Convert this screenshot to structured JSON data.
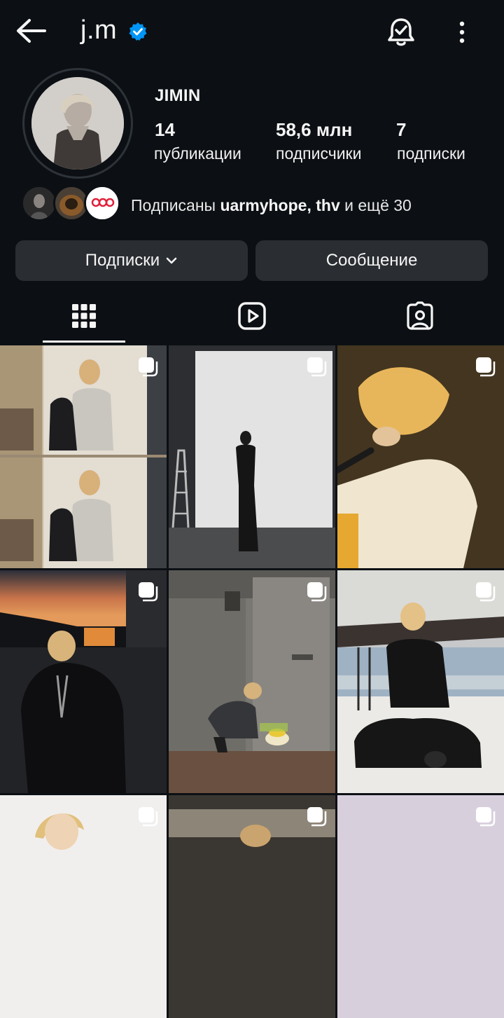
{
  "header": {
    "username": "j.m",
    "verified": true,
    "icons": [
      "back-arrow-icon",
      "verified-badge-icon",
      "notification-bell-icon",
      "more-vertical-icon"
    ]
  },
  "profile": {
    "display_name": "JIMIN",
    "stats": {
      "posts_count": "14",
      "posts_label": "публикации",
      "followers_count": "58,6 млн",
      "followers_label": "подписчики",
      "following_count": "7",
      "following_label": "подписки"
    },
    "followed_by": {
      "prefix": "Подписаны",
      "user1": "uarmyhope",
      "sep": ",",
      "user2": "thv",
      "suffix": "и ещё 30"
    }
  },
  "actions": {
    "following_label": "Подписки",
    "message_label": "Сообщение"
  },
  "tabs": [
    {
      "name": "grid",
      "icon": "grid-icon",
      "active": true
    },
    {
      "name": "reels",
      "icon": "reels-icon",
      "active": false
    },
    {
      "name": "tagged",
      "icon": "tagged-icon",
      "active": false
    }
  ],
  "colors": {
    "background": "#0c1014",
    "button_bg": "#2a2e33",
    "verified": "#0095f6"
  }
}
